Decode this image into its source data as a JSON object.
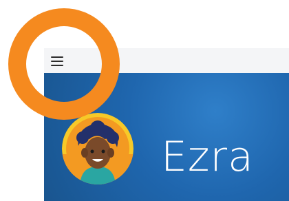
{
  "brand": {
    "name": "Ezra"
  },
  "colors": {
    "ring": "#f58a1f",
    "hero_bg": "#1f66ae",
    "topbar_bg": "#f4f5f7"
  },
  "icons": {
    "menu": "hamburger-menu",
    "avatar": "child-avatar"
  }
}
